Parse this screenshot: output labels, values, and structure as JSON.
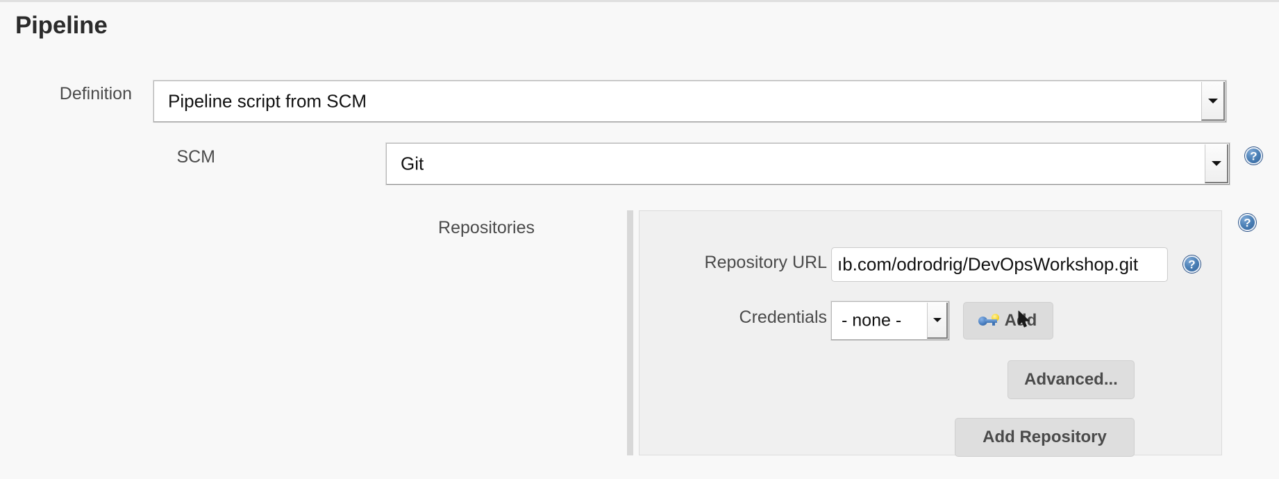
{
  "page": {
    "title": "Pipeline"
  },
  "definition_row": {
    "label": "Definition",
    "select_value": "Pipeline script from SCM",
    "arrow_icon": "chevron-down-icon"
  },
  "scm_row": {
    "label": "SCM",
    "select_value": "Git",
    "arrow_icon": "chevron-down-icon",
    "help_icon": "help-circle-icon"
  },
  "repositories": {
    "label": "Repositories",
    "help_icon": "help-circle-icon",
    "repository_url": {
      "label": "Repository URL",
      "value": "ıb.com/odrodrig/DevOpsWorkshop.git",
      "help_icon": "help-circle-icon"
    },
    "credentials": {
      "label": "Credentials",
      "select_value": "- none -",
      "arrow_icon": "chevron-down-icon",
      "add_button": {
        "label": "Add",
        "icon": "key-icon"
      }
    },
    "advanced_button": "Advanced...",
    "add_repository_button": "Add Repository"
  },
  "colors": {
    "page_background": "#f8f8f8",
    "panel_background": "#f0f0f0",
    "button_background": "#dedede",
    "help_blue": "#4a7fb5",
    "text": "#333333"
  }
}
